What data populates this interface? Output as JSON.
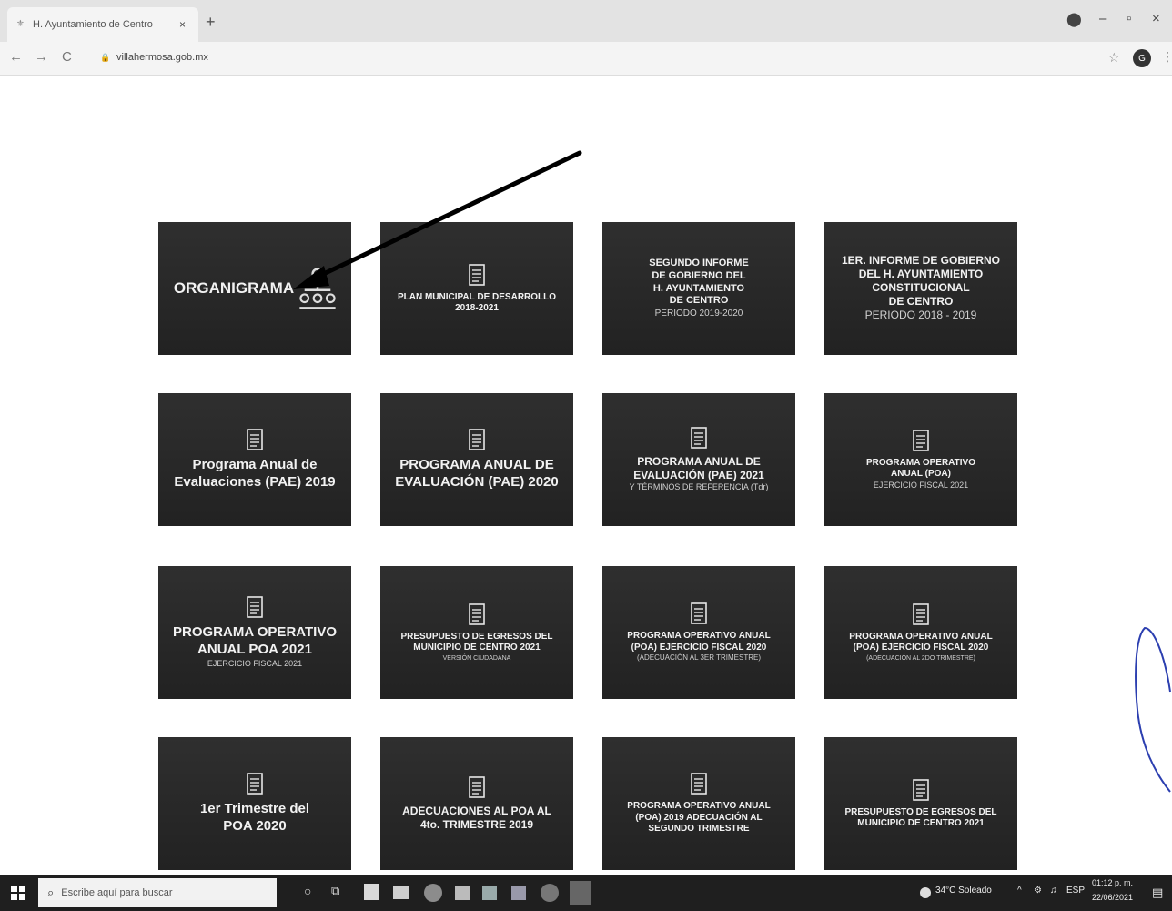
{
  "browser": {
    "tab_title": "H. Ayuntamiento de Centro",
    "tab_close": "×",
    "new_tab": "+",
    "url": "villahermosa.gob.mx",
    "back": "←",
    "forward": "→",
    "reload": "C",
    "star": "☆",
    "profile_initial": "G",
    "menu": "⋮",
    "minimize": "–",
    "maximize": "▫",
    "close": "×"
  },
  "tiles": [
    {
      "lines": [
        "ORGANIGRAMA"
      ],
      "sub": []
    },
    {
      "lines": [
        "PLAN MUNICIPAL DE DESARROLLO",
        "2018-2021"
      ],
      "sub": []
    },
    {
      "lines": [
        "SEGUNDO INFORME",
        "DE GOBIERNO DEL",
        "H. AYUNTAMIENTO",
        "DE CENTRO"
      ],
      "sub": [
        "PERIODO 2019-2020"
      ]
    },
    {
      "lines": [
        "1ER. INFORME DE GOBIERNO",
        "DEL H. AYUNTAMIENTO",
        "CONSTITUCIONAL",
        "DE CENTRO"
      ],
      "sub": [
        "PERIODO 2018 - 2019"
      ]
    },
    {
      "lines": [
        "Programa Anual de",
        "Evaluaciones (PAE) 2019"
      ],
      "sub": []
    },
    {
      "lines": [
        "PROGRAMA ANUAL DE",
        "EVALUACIÓN (PAE) 2020"
      ],
      "sub": []
    },
    {
      "lines": [
        "PROGRAMA ANUAL DE",
        "EVALUACIÓN (PAE) 2021"
      ],
      "sub": [
        "Y TÉRMINOS DE REFERENCIA (Tdr)"
      ]
    },
    {
      "lines": [
        "PROGRAMA OPERATIVO",
        "ANUAL (POA)"
      ],
      "sub": [
        "EJERCICIO FISCAL 2021"
      ]
    },
    {
      "lines": [
        "PROGRAMA OPERATIVO",
        "ANUAL POA 2021"
      ],
      "sub": [
        "EJERCICIO FISCAL 2021"
      ]
    },
    {
      "lines": [
        "PRESUPUESTO DE EGRESOS DEL",
        "MUNICIPIO DE CENTRO 2021"
      ],
      "sub": [
        "VERSIÓN CIUDADANA"
      ]
    },
    {
      "lines": [
        "PROGRAMA OPERATIVO ANUAL",
        "(POA) EJERCICIO FISCAL 2020"
      ],
      "sub": [
        "(ADECUACIÓN AL 3ER TRIMESTRE)"
      ]
    },
    {
      "lines": [
        "PROGRAMA OPERATIVO ANUAL",
        "(POA) EJERCICIO FISCAL 2020"
      ],
      "sub": [
        "(ADECUACIÓN AL 2DO TRIMESTRE)"
      ]
    },
    {
      "lines": [
        "1er Trimestre del",
        "POA 2020"
      ],
      "sub": []
    },
    {
      "lines": [
        "ADECUACIONES AL POA AL",
        "4to. TRIMESTRE 2019"
      ],
      "sub": []
    },
    {
      "lines": [
        "PROGRAMA OPERATIVO ANUAL",
        "(POA) 2019 ADECUACIÓN AL",
        "SEGUNDO TRIMESTRE"
      ],
      "sub": []
    },
    {
      "lines": [
        "PRESUPUESTO DE EGRESOS DEL",
        "MUNICIPIO DE CENTRO 2021"
      ],
      "sub": []
    }
  ],
  "taskbar": {
    "search_placeholder": "Escribe aquí para buscar",
    "weather": "34°C Soleado",
    "tray_chevron": "^",
    "language": "ESP",
    "time": "01:12 p. m.",
    "date": "22/06/2021"
  },
  "colors": {
    "tile_bg": "#262626",
    "tile_text": "#f2f2f2",
    "taskbar_bg": "#1f1f1f",
    "annotation_arrow": "#000000",
    "scribble": "#2c3fb0"
  }
}
